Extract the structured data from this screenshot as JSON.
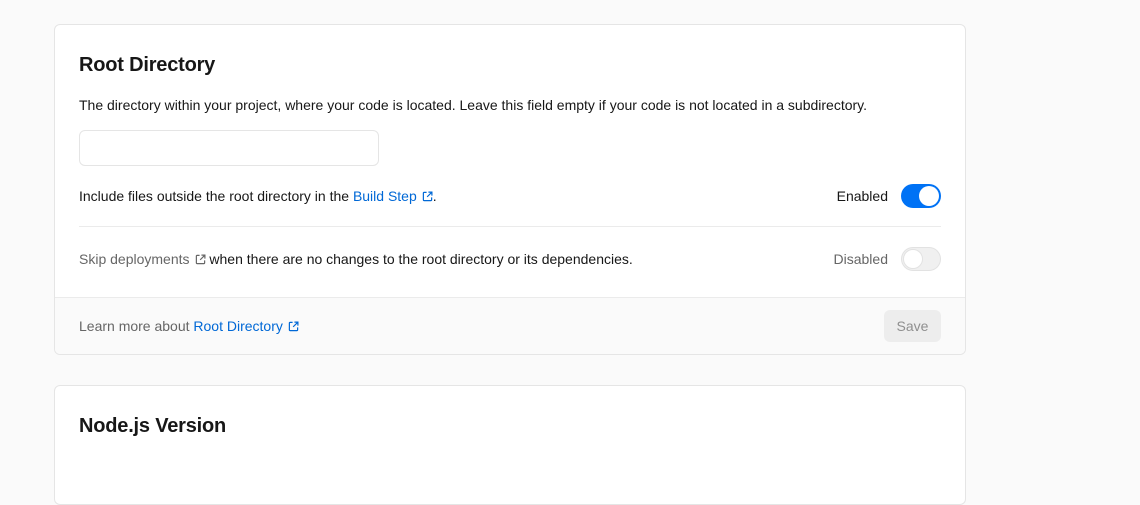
{
  "root_directory": {
    "title": "Root Directory",
    "description": "The directory within your project, where your code is located. Leave this field empty if your code is not located in a subdirectory.",
    "input": {
      "value": "",
      "placeholder": ""
    },
    "include_row": {
      "text_before": "Include files outside the root directory in the ",
      "link_text": "Build Step",
      "text_after": ".",
      "status": "Enabled",
      "enabled": true
    },
    "skip_row": {
      "link_text": "Skip deployments",
      "text_after": " when there are no changes to the root directory or its dependencies.",
      "status": "Disabled",
      "enabled": false
    },
    "footer": {
      "text": "Learn more about ",
      "link_text": "Root Directory",
      "save_label": "Save"
    }
  },
  "nodejs_version": {
    "title": "Node.js Version"
  },
  "colors": {
    "link": "#0068d6",
    "toggle_on": "#0072f5",
    "background": "#fafafa"
  },
  "icons": {
    "external_link": "external-link-icon"
  }
}
